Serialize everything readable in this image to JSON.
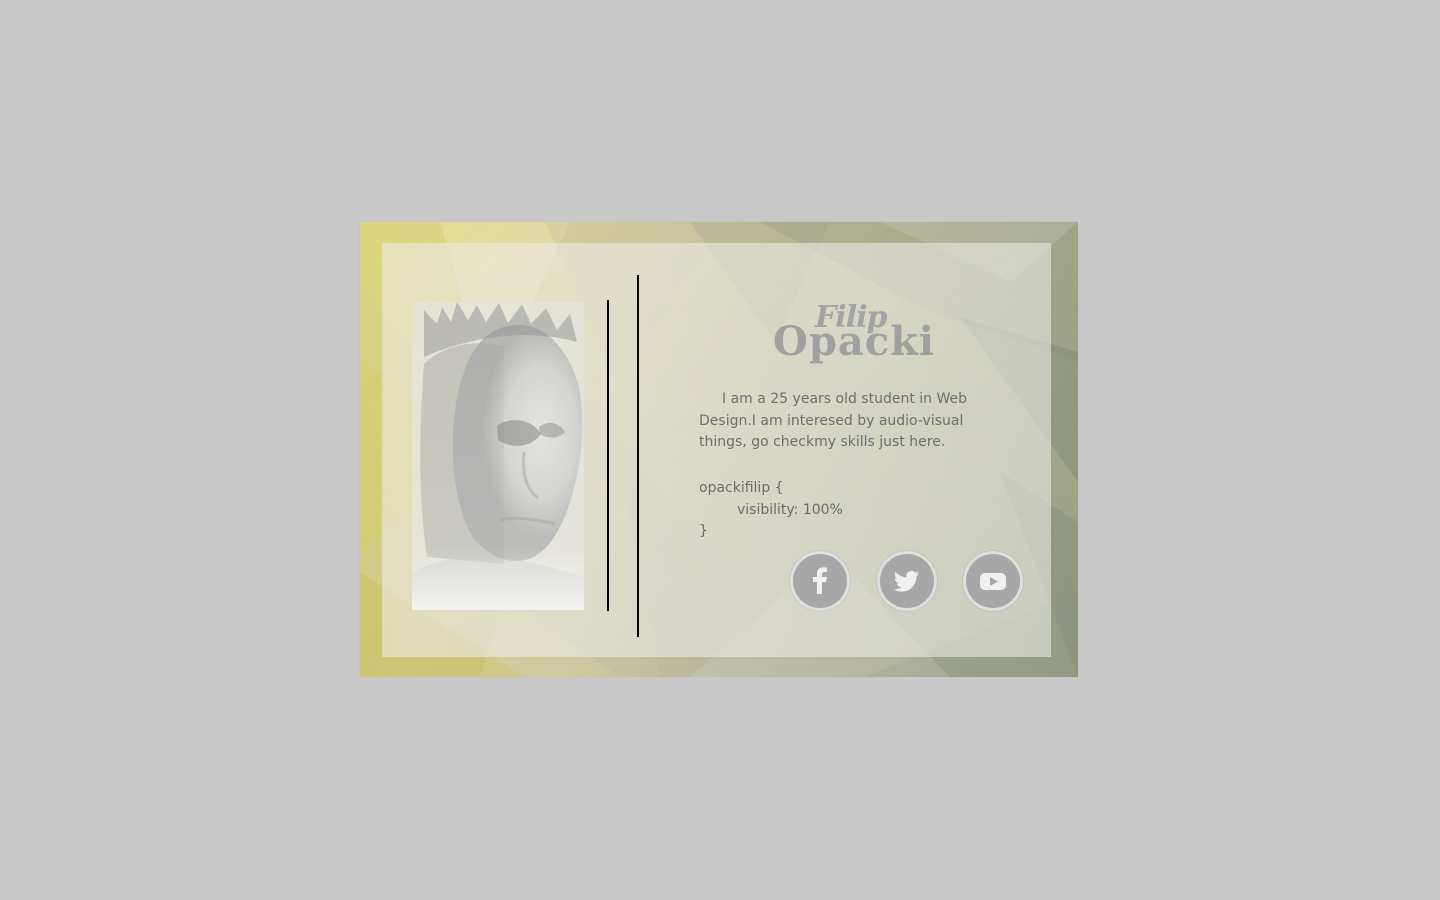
{
  "profile": {
    "first_name": "Filip",
    "last_name": "Opacki",
    "bio": "I am a 25 years old student in Web Design.I am interesed by audio-visual things, go checkmy skills just here.",
    "code": {
      "line1": "opackifilip {",
      "line2": "visibility: 100%",
      "line3": "}"
    }
  },
  "social": {
    "items": [
      {
        "name": "facebook-icon",
        "label": ""
      },
      {
        "name": "twitter-icon",
        "label": ""
      },
      {
        "name": "youtube-icon",
        "label": ""
      }
    ]
  },
  "colors": {
    "page_background": "#c8c8c8",
    "card_yellow": "#c9bf5f",
    "card_green_gray": "#98a18c",
    "panel_overlay": "#ecece7",
    "icon_gray": "#a7a7a7",
    "text_gray": "#6e6e6e"
  }
}
